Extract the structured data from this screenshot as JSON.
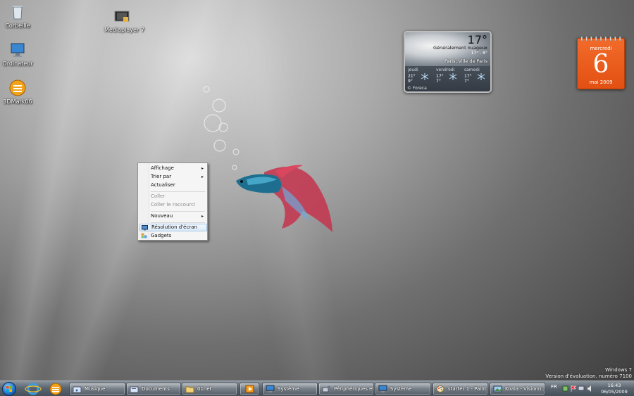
{
  "desktop_icons": [
    {
      "label": "Corbeille",
      "icon": "recycle-bin-icon"
    },
    {
      "label": "Ordinateur",
      "icon": "computer-icon"
    },
    {
      "label": "3DMark06",
      "icon": "3dmark-icon"
    },
    {
      "label": "Mediaplayer 7",
      "icon": "media-player-icon"
    }
  ],
  "weather": {
    "temperature": "17°",
    "condition": "Généralement nuageux",
    "range": "17° - 8°",
    "location": "Paris, Ville de Paris",
    "forecast": [
      {
        "day": "jeudi",
        "high": "21°",
        "low": "9°",
        "icon": "snowflake-icon"
      },
      {
        "day": "vendredi",
        "high": "17°",
        "low": "7°",
        "icon": "snowflake-icon"
      },
      {
        "day": "samedi",
        "high": "17°",
        "low": "7°",
        "icon": "snowflake-icon"
      }
    ],
    "provider": "© Foreca"
  },
  "calendar": {
    "weekday": "mercredi",
    "day": "6",
    "month_year": "mai 2009",
    "color": "#e8561a"
  },
  "context_menu": {
    "items": [
      {
        "label": "Affichage",
        "submenu": true,
        "disabled": false
      },
      {
        "label": "Trier par",
        "submenu": true,
        "disabled": false
      },
      {
        "label": "Actualiser",
        "submenu": false,
        "disabled": false
      },
      {
        "label": "Coller",
        "submenu": false,
        "disabled": true
      },
      {
        "label": "Coller le raccourci",
        "submenu": false,
        "disabled": true
      },
      {
        "label": "Nouveau",
        "submenu": true,
        "disabled": false
      },
      {
        "label": "Résolution d'écran",
        "submenu": false,
        "disabled": false,
        "icon": "screen-resolution-icon",
        "highlighted": true
      },
      {
        "label": "Gadgets",
        "submenu": false,
        "disabled": false,
        "icon": "gadgets-icon"
      }
    ],
    "submenu_arrow": "▸"
  },
  "taskbar": {
    "pinned": [
      "windows-start-icon",
      "internet-explorer-icon",
      "3dmark-icon"
    ],
    "buttons": [
      {
        "label": "Musique",
        "icon": "music-folder-icon"
      },
      {
        "label": "Documents",
        "icon": "documents-folder-icon"
      },
      {
        "label": "01net",
        "icon": "folder-icon"
      },
      {
        "label": "",
        "icon": "media-player-icon"
      },
      {
        "label": "Système",
        "icon": "system-icon"
      },
      {
        "label": "Périphériques et...",
        "icon": "devices-icon"
      },
      {
        "label": "Système",
        "icon": "system-icon"
      },
      {
        "label": "starter 1 - Paint",
        "icon": "paint-icon"
      },
      {
        "label": "Koala - Visionn...",
        "icon": "photo-viewer-icon"
      }
    ],
    "language": "FR",
    "time": "16:43",
    "date": "06/05/2009"
  },
  "watermark": {
    "line1": "Windows 7",
    "line2": "Version d'évaluation. numéro 7100"
  }
}
